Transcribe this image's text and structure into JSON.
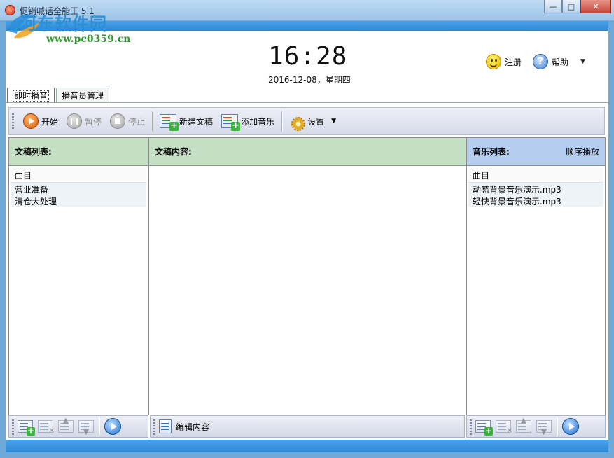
{
  "window": {
    "title": "促销喊话全能王 5.1",
    "watermark": "河东软件园",
    "watermark_url": "www.pc0359.cn",
    "minimize_label": "—",
    "maximize_label": "□",
    "close_label": "✕"
  },
  "header": {
    "time": "16:28",
    "date": "2016-12-08，星期四",
    "register_label": "注册",
    "help_label": "帮助",
    "help_caret": "▼",
    "help_icon": "?"
  },
  "tabs": [
    {
      "label": "即时播音",
      "active": true
    },
    {
      "label": "播音员管理",
      "active": false
    }
  ],
  "toolbar": {
    "start_label": "开始",
    "pause_label": "暂停",
    "stop_label": "停止",
    "new_doc_label": "新建文稿",
    "add_music_label": "添加音乐",
    "settings_label": "设置",
    "settings_caret": "▼"
  },
  "doc_list": {
    "title": "文稿列表:",
    "column": "曲目",
    "items": [
      "营业准备",
      "清仓大处理"
    ]
  },
  "doc_content": {
    "title": "文稿内容:",
    "edit_label": "编辑内容"
  },
  "music_list": {
    "title": "音乐列表:",
    "mode": "顺序播放",
    "column": "曲目",
    "items": [
      "动感背景音乐演示.mp3",
      "轻快背景音乐演示.mp3"
    ]
  },
  "colors": {
    "doc_header_bg": "#c5dfc5",
    "music_header_bg": "#b4cdef",
    "frame_blue": "#2d88d6"
  }
}
